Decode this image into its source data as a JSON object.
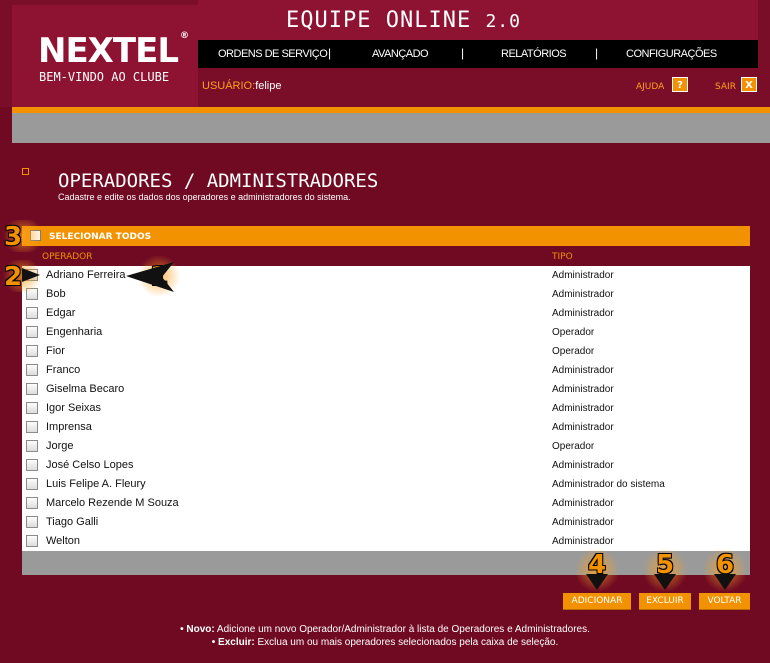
{
  "brand": {
    "logo_text": "NEXTEL",
    "logo_mark": "®",
    "tagline": "BEM-VINDO AO CLUBE"
  },
  "app": {
    "title": "EQUIPE ONLINE",
    "version": "2.0"
  },
  "nav": {
    "items": [
      {
        "label": "ORDENS DE SERVIÇO"
      },
      {
        "label": "AVANÇADO"
      },
      {
        "label": "RELATÓRIOS"
      },
      {
        "label": "CONFIGURAÇÕES"
      }
    ],
    "separator": "|"
  },
  "user": {
    "label": "USUÁRIO:",
    "name": "felipe"
  },
  "help": {
    "label": "AJUDA",
    "icon_glyph": "?"
  },
  "logout": {
    "label": "SAIR",
    "icon_glyph": "X"
  },
  "page": {
    "title": "OPERADORES / ADMINISTRADORES",
    "subtitle": "Cadastre e edite os dados dos operadores e administradores do sistema."
  },
  "table": {
    "select_all_label": "SELECIONAR TODOS",
    "headers": {
      "operator": "OPERADOR",
      "type": "TIPO"
    },
    "rows": [
      {
        "operator": "Adriano Ferreira",
        "type": "Administrador"
      },
      {
        "operator": "Bob",
        "type": "Administrador"
      },
      {
        "operator": "Edgar",
        "type": "Administrador"
      },
      {
        "operator": "Engenharia",
        "type": "Operador"
      },
      {
        "operator": "Fior",
        "type": "Operador"
      },
      {
        "operator": "Franco",
        "type": "Administrador"
      },
      {
        "operator": "Giselma Becaro",
        "type": "Administrador"
      },
      {
        "operator": "Igor Seixas",
        "type": "Administrador"
      },
      {
        "operator": "Imprensa",
        "type": "Administrador"
      },
      {
        "operator": "Jorge",
        "type": "Operador"
      },
      {
        "operator": "José Celso Lopes",
        "type": "Administrador"
      },
      {
        "operator": "Luis Felipe A. Fleury",
        "type": "Administrador do sistema"
      },
      {
        "operator": "Marcelo Rezende M Souza",
        "type": "Administrador"
      },
      {
        "operator": "Tiago Galli",
        "type": "Administrador"
      },
      {
        "operator": "Welton",
        "type": "Administrador"
      }
    ]
  },
  "actions": {
    "add": "ADICIONAR",
    "delete": "EXCLUIR",
    "back": "VOLTAR"
  },
  "help_text": {
    "line1_key": "• Novo:",
    "line1_text": " Adicione um novo Operador/Administrador à lista de Operadores e Administradores.",
    "line2_key": "• Excluir:",
    "line2_text": " Exclua um ou mais operadores selecionados pela caixa de seleção."
  },
  "callouts": [
    "1",
    "2",
    "3",
    "4",
    "5",
    "6"
  ],
  "colors": {
    "background": "#6f0a22",
    "accent": "#f29200",
    "header": "#8e1232",
    "nav": "#000000",
    "gray": "#9a9a9a"
  }
}
